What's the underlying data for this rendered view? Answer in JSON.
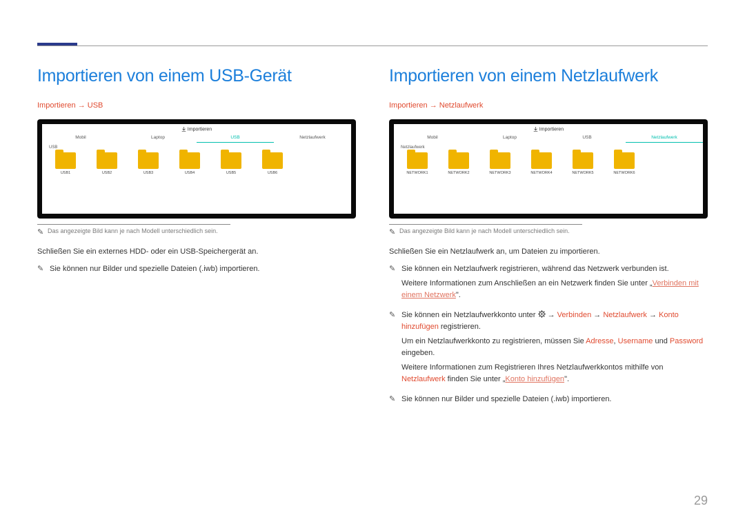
{
  "page_number": "29",
  "left": {
    "heading": "Importieren von einem USB-Gerät",
    "breadcrumb": "Importieren → USB",
    "tv_header": "Importieren",
    "tabs": [
      "Mobil",
      "Laptop",
      "USB",
      "Netzlaufwerk"
    ],
    "active_tab_index": 2,
    "sublabel": "USB",
    "folders": [
      "USB1",
      "USB2",
      "USB3",
      "USB4",
      "USB5",
      "USB6"
    ],
    "caption": "Das angezeigte Bild kann je nach Modell unterschiedlich sein.",
    "body": "Schließen Sie ein externes HDD- oder ein USB-Speichergerät an.",
    "note": "Sie können nur Bilder und spezielle Dateien (.iwb) importieren."
  },
  "right": {
    "heading": "Importieren von einem Netzlaufwerk",
    "breadcrumb": "Importieren → Netzlaufwerk",
    "tv_header": "Importieren",
    "tabs": [
      "Mobil",
      "Laptop",
      "USB",
      "Netzlaufwerk"
    ],
    "active_tab_index": 3,
    "sublabel": "Netzlaufwerk",
    "folders": [
      "NETWORK1",
      "NETWORK2",
      "NETWORK3",
      "NETWORK4",
      "NETWORK5",
      "NETWORK6"
    ],
    "caption": "Das angezeigte Bild kann je nach Modell unterschiedlich sein.",
    "body": "Schließen Sie ein Netzlaufwerk an, um Dateien zu importieren.",
    "notes": {
      "n1a": "Sie können ein Netzlaufwerk registrieren, während das Netzwerk verbunden ist.",
      "n1b_pre": "Weitere Informationen zum Anschließen an ein Netzwerk finden Sie unter „",
      "n1b_link": "Verbinden mit einem Netzwerk",
      "n1b_post": "\".",
      "n2_pre": "Sie können ein Netzlaufwerkkonto unter ",
      "n2_arrow1": " → ",
      "n2_verbinden": "Verbinden",
      "n2_arrow2": " → ",
      "n2_netz": "Netzlaufwerk",
      "n2_arrow3": " → ",
      "n2_konto": "Konto hinzufügen",
      "n2_post": " registrieren.",
      "n2b_pre": "Um ein Netzlaufwerkkonto zu registrieren, müssen Sie ",
      "n2b_adr": "Adresse",
      "n2b_c1": ", ",
      "n2b_user": "Username",
      "n2b_c2": " und ",
      "n2b_pass": "Password",
      "n2b_post": " eingeben.",
      "n2c_pre": "Weitere Informationen zum Registrieren Ihres Netzlaufwerkkontos mithilfe von ",
      "n2c_netz": "Netzlaufwerk",
      "n2c_mid": " finden Sie unter „",
      "n2c_link": "Konto hinzufügen",
      "n2c_post": "\".",
      "n3": "Sie können nur Bilder und spezielle Dateien (.iwb) importieren."
    }
  }
}
